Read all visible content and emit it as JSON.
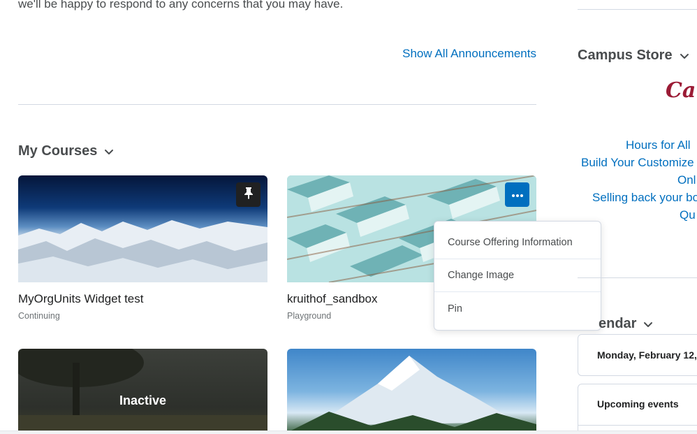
{
  "announcements": {
    "intro_text": "we'll be happy to respond to any concerns that you may have.",
    "show_all_label": "Show All Announcements"
  },
  "my_courses": {
    "heading": "My Courses",
    "courses": [
      {
        "title": "MyOrgUnits Widget test",
        "subtitle": "Continuing",
        "pinned": true
      },
      {
        "title": "kruithof_sandbox",
        "subtitle": "Playground",
        "pinned": false
      },
      {
        "title": "",
        "subtitle": "",
        "status_label": "Inactive"
      },
      {
        "title": "",
        "subtitle": ""
      }
    ],
    "context_menu": {
      "items": [
        "Course Offering Information",
        "Change Image",
        "Pin"
      ]
    }
  },
  "campus_store": {
    "heading": "Campus Store",
    "logo_text": "Can",
    "links": [
      "Hours for All",
      "Build Your Customize",
      "Onl",
      "Selling back your bo",
      "Qu"
    ]
  },
  "calendar": {
    "heading": "endar",
    "date_label": "Monday, February 12,",
    "upcoming_label": "Upcoming events"
  },
  "colors": {
    "link": "#006fbf",
    "pin_button": "#202122",
    "more_button": "#006fbf",
    "store_brand": "#9b1b35"
  },
  "icons": {
    "chevron": "chevron-down-icon",
    "pin": "pin-icon",
    "more": "more-horizontal-icon"
  }
}
